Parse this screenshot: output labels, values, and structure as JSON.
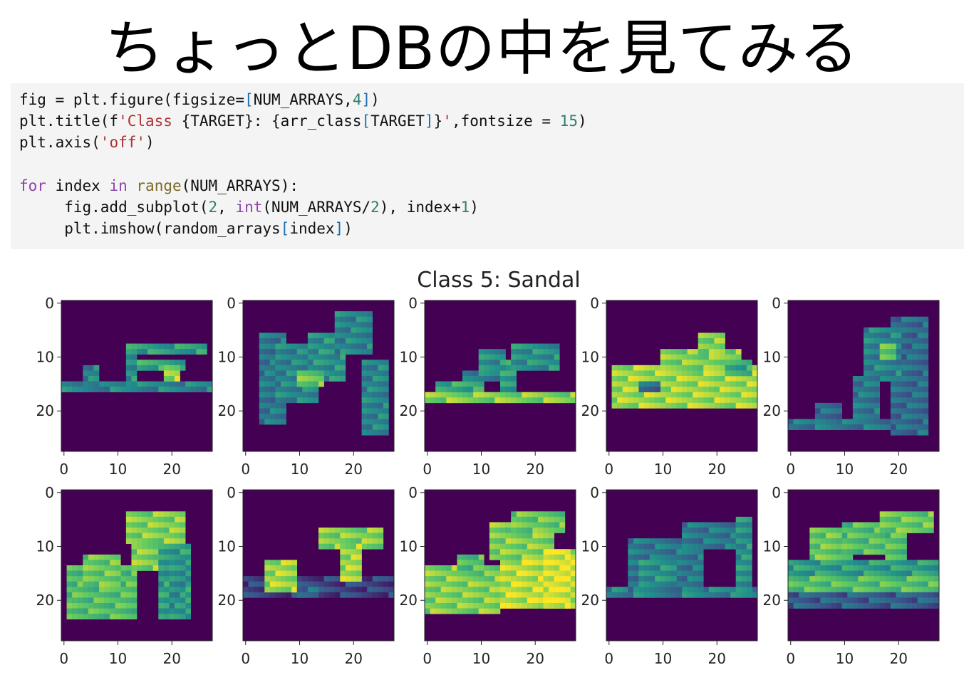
{
  "slide": {
    "title": "ちょっとDBの中を見てみる"
  },
  "code": {
    "lines": [
      [
        {
          "t": "fig = plt.figure(figsize="
        },
        {
          "t": "[",
          "c": "brk"
        },
        {
          "t": "NUM_ARRAYS,"
        },
        {
          "t": "4",
          "c": "num"
        },
        {
          "t": "]",
          "c": "brk"
        },
        {
          "t": ")"
        }
      ],
      [
        {
          "t": "plt.title(f"
        },
        {
          "t": "'Class ",
          "c": "str"
        },
        {
          "t": "{TARGET}: {arr_class"
        },
        {
          "t": "[",
          "c": "brk"
        },
        {
          "t": "TARGET"
        },
        {
          "t": "]",
          "c": "brk"
        },
        {
          "t": "}"
        },
        {
          "t": "'",
          "c": "str"
        },
        {
          "t": ",fontsize = "
        },
        {
          "t": "15",
          "c": "num"
        },
        {
          "t": ")"
        }
      ],
      [
        {
          "t": "plt.axis("
        },
        {
          "t": "'off'",
          "c": "str"
        },
        {
          "t": ")"
        }
      ],
      [
        {
          "t": ""
        }
      ],
      [
        {
          "t": "for",
          "c": "kw"
        },
        {
          "t": " index "
        },
        {
          "t": "in",
          "c": "kw"
        },
        {
          "t": " "
        },
        {
          "t": "range",
          "c": "bi"
        },
        {
          "t": "(NUM_ARRAYS):"
        }
      ],
      [
        {
          "t": "     fig.add_subplot("
        },
        {
          "t": "2",
          "c": "num"
        },
        {
          "t": ", "
        },
        {
          "t": "int",
          "c": "kw"
        },
        {
          "t": "(NUM_ARRAYS/"
        },
        {
          "t": "2",
          "c": "num"
        },
        {
          "t": "), index+"
        },
        {
          "t": "1",
          "c": "num"
        },
        {
          "t": ")"
        }
      ],
      [
        {
          "t": "     plt.imshow(random_arrays"
        },
        {
          "t": "[",
          "c": "brk"
        },
        {
          "t": "index"
        },
        {
          "t": "]",
          "c": "brk"
        },
        {
          "t": ")"
        }
      ]
    ]
  },
  "chart_data": {
    "type": "heatmap",
    "title": "Class 5: Sandal",
    "layout": {
      "rows": 2,
      "cols": 5
    },
    "colormap": "viridis",
    "background_color": "#440154",
    "axis_ticks": {
      "x": [
        "0",
        "10",
        "20"
      ],
      "y": [
        "0",
        "10",
        "20"
      ]
    },
    "image_size": [
      28,
      28
    ],
    "panels": [
      {
        "index": 1,
        "shapes": [
          {
            "r": [
              15,
              16
            ],
            "c": [
              0,
              27
            ],
            "v": 0.45
          },
          {
            "r": [
              12,
              15
            ],
            "c": [
              4,
              6
            ],
            "v": 0.45
          },
          {
            "r": [
              8,
              9
            ],
            "c": [
              12,
              26
            ],
            "v": 0.55
          },
          {
            "r": [
              9,
              15
            ],
            "c": [
              12,
              13
            ],
            "v": 0.5
          },
          {
            "r": [
              11,
              12
            ],
            "c": [
              14,
              22
            ],
            "v": 0.6
          },
          {
            "r": [
              12,
              14
            ],
            "c": [
              19,
              21
            ],
            "v": 0.85
          }
        ]
      },
      {
        "index": 2,
        "shapes": [
          {
            "r": [
              6,
              22
            ],
            "c": [
              3,
              7
            ],
            "v": 0.4
          },
          {
            "r": [
              8,
              18
            ],
            "c": [
              6,
              13
            ],
            "v": 0.45
          },
          {
            "r": [
              6,
              14
            ],
            "c": [
              12,
              18
            ],
            "v": 0.5
          },
          {
            "r": [
              2,
              9
            ],
            "c": [
              17,
              23
            ],
            "v": 0.45
          },
          {
            "r": [
              11,
              24
            ],
            "c": [
              22,
              26
            ],
            "v": 0.45
          },
          {
            "r": [
              13,
              15
            ],
            "c": [
              10,
              14
            ],
            "v": 0.75
          }
        ]
      },
      {
        "index": 3,
        "shapes": [
          {
            "r": [
              17,
              18
            ],
            "c": [
              0,
              27
            ],
            "v": 0.8
          },
          {
            "r": [
              15,
              16
            ],
            "c": [
              2,
              10
            ],
            "v": 0.6
          },
          {
            "r": [
              13,
              14
            ],
            "c": [
              7,
              13
            ],
            "v": 0.45
          },
          {
            "r": [
              11,
              16
            ],
            "c": [
              14,
              16
            ],
            "v": 0.55
          },
          {
            "r": [
              8,
              12
            ],
            "c": [
              16,
              24
            ],
            "v": 0.5
          },
          {
            "r": [
              9,
              12
            ],
            "c": [
              10,
              14
            ],
            "v": 0.5
          }
        ]
      },
      {
        "index": 4,
        "shapes": [
          {
            "r": [
              12,
              19
            ],
            "c": [
              1,
              27
            ],
            "v": 0.85
          },
          {
            "r": [
              9,
              12
            ],
            "c": [
              10,
              24
            ],
            "v": 0.8
          },
          {
            "r": [
              6,
              9
            ],
            "c": [
              17,
              21
            ],
            "v": 0.8
          },
          {
            "r": [
              11,
              13
            ],
            "c": [
              22,
              26
            ],
            "v": 0.6
          },
          {
            "r": [
              15,
              16
            ],
            "c": [
              6,
              9
            ],
            "v": 0.35
          }
        ]
      },
      {
        "index": 5,
        "shapes": [
          {
            "r": [
              3,
              24
            ],
            "c": [
              19,
              25
            ],
            "v": 0.35
          },
          {
            "r": [
              5,
              14
            ],
            "c": [
              14,
              20
            ],
            "v": 0.45
          },
          {
            "r": [
              14,
              21
            ],
            "c": [
              12,
              16
            ],
            "v": 0.4
          },
          {
            "r": [
              22,
              23
            ],
            "c": [
              0,
              18
            ],
            "v": 0.4
          },
          {
            "r": [
              19,
              22
            ],
            "c": [
              5,
              9
            ],
            "v": 0.35
          },
          {
            "r": [
              8,
              10
            ],
            "c": [
              17,
              19
            ],
            "v": 0.75
          }
        ]
      },
      {
        "index": 6,
        "shapes": [
          {
            "r": [
              14,
              23
            ],
            "c": [
              1,
              13
            ],
            "v": 0.7
          },
          {
            "r": [
              12,
              17
            ],
            "c": [
              4,
              10
            ],
            "v": 0.75
          },
          {
            "r": [
              8,
              14
            ],
            "c": [
              13,
              18
            ],
            "v": 0.8
          },
          {
            "r": [
              4,
              9
            ],
            "c": [
              12,
              22
            ],
            "v": 0.8
          },
          {
            "r": [
              10,
              23
            ],
            "c": [
              18,
              23
            ],
            "v": 0.55
          },
          {
            "r": [
              13,
              23
            ],
            "c": [
              20,
              22
            ],
            "v": 0.5
          }
        ]
      },
      {
        "index": 7,
        "shapes": [
          {
            "r": [
              16,
              19
            ],
            "c": [
              0,
              27
            ],
            "v": 0.2
          },
          {
            "r": [
              13,
              18
            ],
            "c": [
              4,
              9
            ],
            "v": 0.85
          },
          {
            "r": [
              7,
              10
            ],
            "c": [
              14,
              25
            ],
            "v": 0.8
          },
          {
            "r": [
              10,
              16
            ],
            "c": [
              18,
              21
            ],
            "v": 0.85
          },
          {
            "r": [
              18,
              19
            ],
            "c": [
              10,
              13
            ],
            "v": 0.35
          }
        ]
      },
      {
        "index": 8,
        "shapes": [
          {
            "r": [
              14,
              22
            ],
            "c": [
              0,
              13
            ],
            "v": 0.8
          },
          {
            "r": [
              12,
              15
            ],
            "c": [
              6,
              10
            ],
            "v": 0.7
          },
          {
            "r": [
              11,
              21
            ],
            "c": [
              14,
              27
            ],
            "v": 0.9
          },
          {
            "r": [
              6,
              12
            ],
            "c": [
              12,
              23
            ],
            "v": 0.8
          },
          {
            "r": [
              4,
              7
            ],
            "c": [
              16,
              25
            ],
            "v": 0.75
          },
          {
            "r": [
              11,
              21
            ],
            "c": [
              22,
              26
            ],
            "v": 0.95
          }
        ]
      },
      {
        "index": 9,
        "shapes": [
          {
            "r": [
              18,
              19
            ],
            "c": [
              0,
              27
            ],
            "v": 0.45
          },
          {
            "r": [
              9,
              18
            ],
            "c": [
              4,
              17
            ],
            "v": 0.4
          },
          {
            "r": [
              6,
              10
            ],
            "c": [
              14,
              26
            ],
            "v": 0.4
          },
          {
            "r": [
              5,
              18
            ],
            "c": [
              24,
              26
            ],
            "v": 0.5
          },
          {
            "r": [
              13,
              17
            ],
            "c": [
              6,
              12
            ],
            "v": 0.5
          }
        ]
      },
      {
        "index": 10,
        "shapes": [
          {
            "r": [
              13,
              15
            ],
            "c": [
              0,
              27
            ],
            "v": 0.55
          },
          {
            "r": [
              16,
              18
            ],
            "c": [
              0,
              27
            ],
            "v": 0.7
          },
          {
            "r": [
              19,
              21
            ],
            "c": [
              0,
              27
            ],
            "v": 0.3
          },
          {
            "r": [
              7,
              12
            ],
            "c": [
              4,
              11
            ],
            "v": 0.75
          },
          {
            "r": [
              6,
              11
            ],
            "c": [
              10,
              18
            ],
            "v": 0.7
          },
          {
            "r": [
              4,
              7
            ],
            "c": [
              17,
              26
            ],
            "v": 0.75
          },
          {
            "r": [
              8,
              12
            ],
            "c": [
              18,
              21
            ],
            "v": 0.7
          }
        ]
      }
    ]
  }
}
